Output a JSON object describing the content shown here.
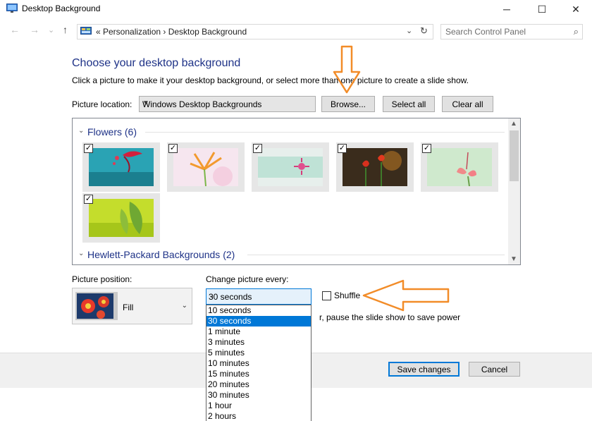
{
  "window": {
    "title": "Desktop Background",
    "minimize_glyph": "─",
    "maximize_glyph": "☐",
    "close_glyph": "✕"
  },
  "nav": {
    "back": "←",
    "forward": "→",
    "recent": "⌄",
    "up": "↑"
  },
  "address": {
    "crumbs": "«   Personalization   ›   Desktop Background",
    "chevron": "⌄",
    "refresh": "↻"
  },
  "search": {
    "placeholder": "Search Control Panel",
    "icon": "⌕"
  },
  "main": {
    "heading": "Choose your desktop background",
    "description": "Click a picture to make it your desktop background, or select more than one picture to create a slide show.",
    "location_label": "Picture location:",
    "location_value": "Windows Desktop Backgrounds",
    "browse_label": "Browse...",
    "select_all_label": "Select all",
    "clear_all_label": "Clear all"
  },
  "gallery": {
    "groups": [
      {
        "name": "Flowers (6)",
        "checked_count": 6
      },
      {
        "name": "Hewlett-Packard Backgrounds (2)"
      }
    ],
    "check_glyph": "✓"
  },
  "position": {
    "label": "Picture position:",
    "value": "Fill"
  },
  "change": {
    "label": "Change picture every:",
    "value": "30 seconds",
    "options": [
      "10 seconds",
      "30 seconds",
      "1 minute",
      "3 minutes",
      "5 minutes",
      "10 minutes",
      "15 minutes",
      "20 minutes",
      "30 minutes",
      "1 hour",
      "2 hours"
    ],
    "selected_index": 1
  },
  "shuffle": {
    "label": "Shuffle",
    "checked": false
  },
  "battery_text": "r, pause the slide show to save power",
  "footer": {
    "save_label": "Save changes",
    "cancel_label": "Cancel"
  },
  "colors": {
    "heading": "#1e3287",
    "accent": "#0078d7",
    "annotation_arrow": "#f28c28"
  }
}
